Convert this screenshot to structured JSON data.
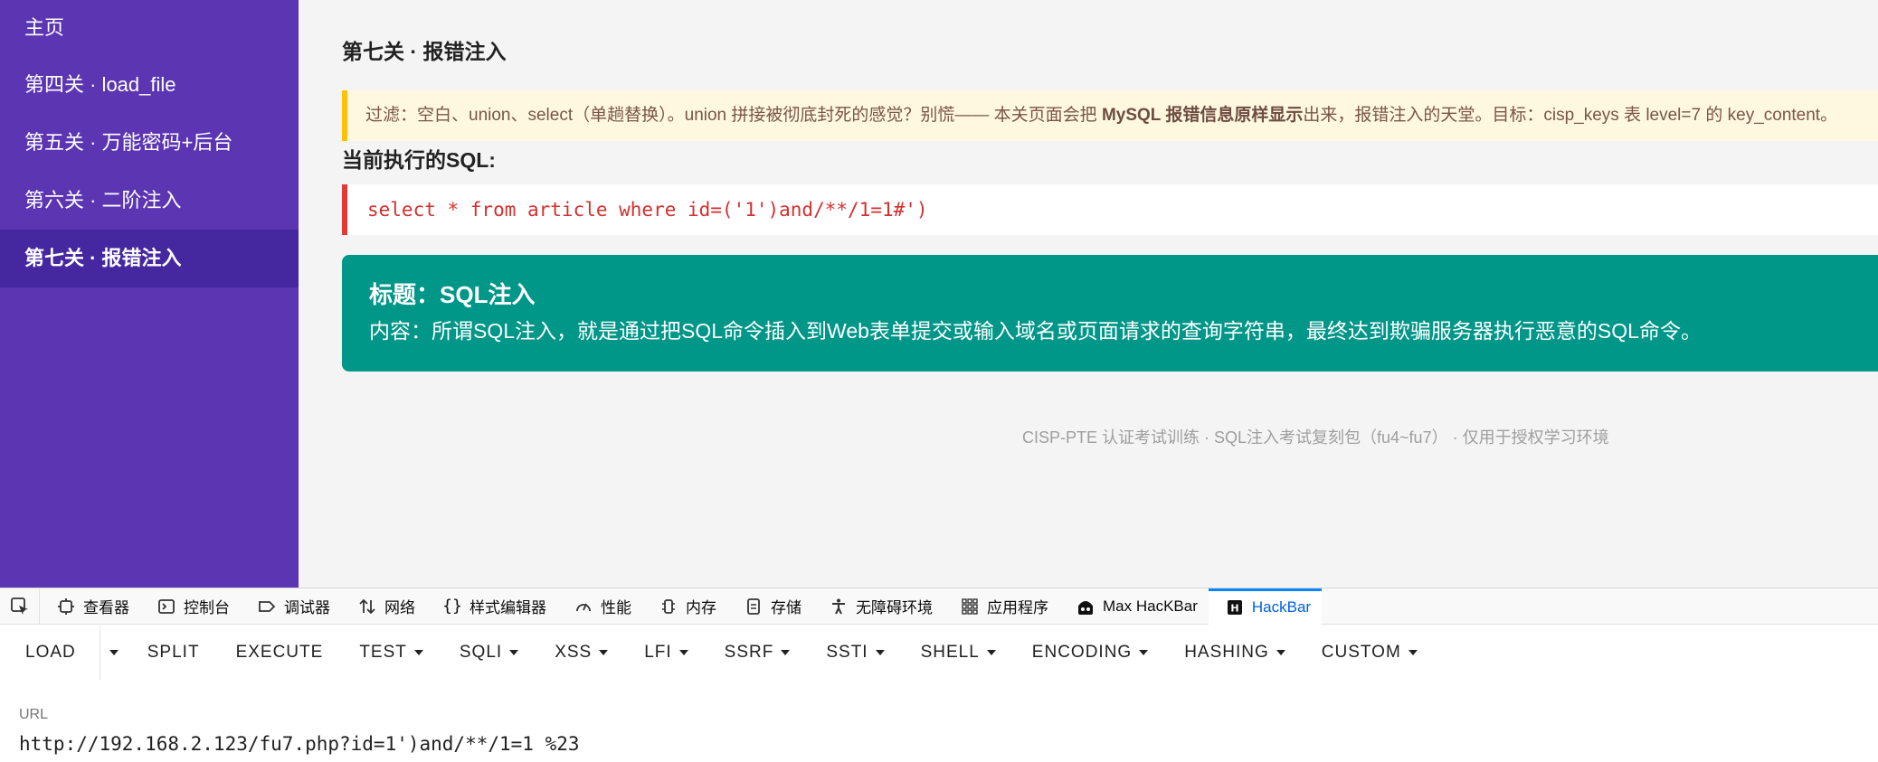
{
  "sidebar": {
    "items": [
      {
        "label": "主页"
      },
      {
        "label": "第四关 · load_file"
      },
      {
        "label": "第五关 · 万能密码+后台"
      },
      {
        "label": "第六关 · 二阶注入"
      },
      {
        "label": "第七关 · 报错注入"
      }
    ]
  },
  "main": {
    "title": "第七关 · 报错注入",
    "notice": {
      "prefix": "过滤：空白、union、select（单趟替换）。union 拼接被彻底封死的感觉？别慌—— 本关页面会把 ",
      "bold": "MySQL 报错信息原样显示",
      "suffix": "出来，报错注入的天堂。目标：cisp_keys 表 level=7 的 key_content。"
    },
    "sql_heading": "当前执行的SQL:",
    "sql": "select * from article where id=('1')and/**/1=1#')",
    "result": {
      "title": "标题：SQL注入",
      "content": "内容：所谓SQL注入，就是通过把SQL命令插入到Web表单提交或输入域名或页面请求的查询字符串，最终达到欺骗服务器执行恶意的SQL命令。"
    },
    "footer": "CISP-PTE 认证考试训练 · SQL注入考试复刻包（fu4~fu7） · 仅用于授权学习环境"
  },
  "devtools": {
    "tabs": [
      {
        "label": "查看器",
        "icon": "inspector-icon"
      },
      {
        "label": "控制台",
        "icon": "console-icon"
      },
      {
        "label": "调试器",
        "icon": "debugger-icon"
      },
      {
        "label": "网络",
        "icon": "network-icon"
      },
      {
        "label": "样式编辑器",
        "icon": "style-editor-icon"
      },
      {
        "label": "性能",
        "icon": "performance-icon"
      },
      {
        "label": "内存",
        "icon": "memory-icon"
      },
      {
        "label": "存储",
        "icon": "storage-icon"
      },
      {
        "label": "无障碍环境",
        "icon": "accessibility-icon"
      },
      {
        "label": "应用程序",
        "icon": "application-icon"
      },
      {
        "label": "Max HacKBar",
        "icon": "max-hackbar-icon"
      },
      {
        "label": "HackBar",
        "icon": "hackbar-icon"
      }
    ]
  },
  "hackbar": {
    "buttons": {
      "load": "LOAD",
      "split": "SPLIT",
      "execute": "EXECUTE",
      "test": "TEST",
      "sqli": "SQLI",
      "xss": "XSS",
      "lfi": "LFI",
      "ssrf": "SSRF",
      "ssti": "SSTI",
      "shell": "SHELL",
      "encoding": "ENCODING",
      "hashing": "HASHING",
      "custom": "CUSTOM"
    },
    "url_label": "URL",
    "url_value": "http://192.168.2.123/fu7.php?id=1')and/**/1=1 %23"
  },
  "colors": {
    "sidebar_bg": "#5c35b2",
    "sidebar_active": "#4527a0",
    "notice_border": "#ffc107",
    "sql_border": "#e53935",
    "sql_text": "#d32f2f",
    "result_card": "#009688",
    "hackbar_active": "#0060df"
  }
}
